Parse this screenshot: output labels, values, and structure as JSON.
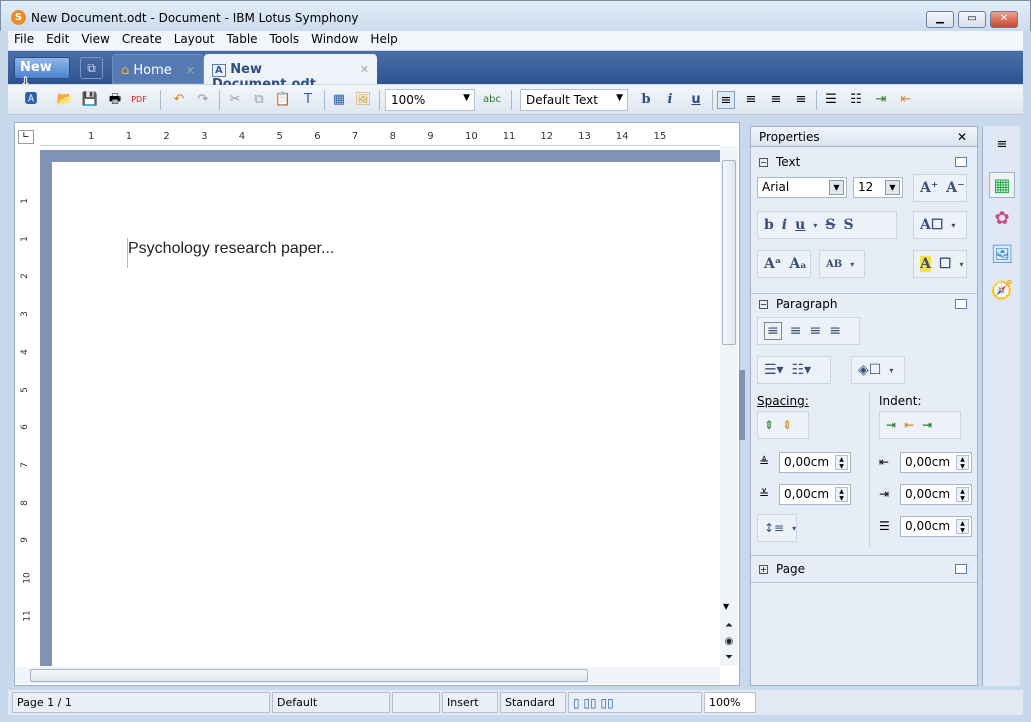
{
  "window": {
    "title": "New Document.odt - Document - IBM Lotus Symphony",
    "app_icon": "S"
  },
  "menu": [
    "File",
    "Edit",
    "View",
    "Create",
    "Layout",
    "Table",
    "Tools",
    "Window",
    "Help"
  ],
  "tabs": {
    "new_label": "New",
    "home_label": "Home",
    "doc_label": "New Document.odt"
  },
  "toolbar": {
    "zoom": "100%",
    "style": "Default Text"
  },
  "ruler": {
    "h_ticks": [
      "1",
      "1",
      "2",
      "3",
      "4",
      "5",
      "6",
      "7",
      "8",
      "9",
      "10",
      "11",
      "12",
      "13",
      "14",
      "15"
    ],
    "v_ticks": [
      "1",
      "1",
      "2",
      "3",
      "4",
      "5",
      "6",
      "7",
      "8",
      "9",
      "10",
      "11"
    ]
  },
  "document": {
    "text": "Psychology research paper..."
  },
  "properties": {
    "title": "Properties",
    "text_section": "Text",
    "font": "Arial",
    "size": "12",
    "paragraph_section": "Paragraph",
    "spacing_label": "Spacing:",
    "indent_label": "Indent:",
    "spacing_above": "0,00cm",
    "spacing_below": "0,00cm",
    "indent_before": "0,00cm",
    "indent_after": "0,00cm",
    "indent_first": "0,00cm",
    "page_section": "Page"
  },
  "status": {
    "page": "Page 1 / 1",
    "style": "Default",
    "mode": "Insert",
    "selection": "Standard",
    "zoom": "100%"
  }
}
